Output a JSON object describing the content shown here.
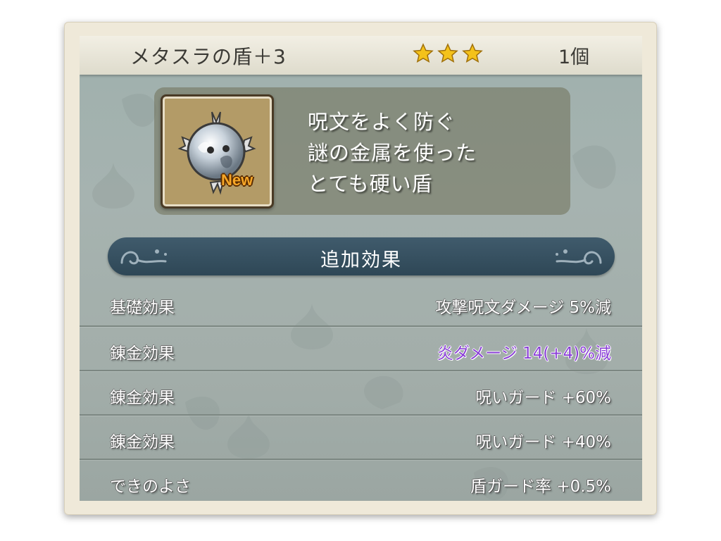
{
  "item": {
    "name": "メタスラの盾＋3",
    "rarity_stars": 3,
    "count": "1個",
    "is_new": true,
    "new_badge": "New",
    "icon": "metal-slime-shield-icon",
    "description_lines": [
      "呪文をよく防ぐ",
      "謎の金属を使った",
      "とても硬い盾"
    ]
  },
  "section": {
    "title": "追加効果"
  },
  "effects": [
    {
      "label": "基礎効果",
      "value": "攻撃呪文ダメージ 5%減"
    },
    {
      "label": "錬金効果",
      "value": "炎ダメージ 14(+4)%減",
      "highlight": true
    },
    {
      "label": "錬金効果",
      "value": "呪いガード +60%"
    },
    {
      "label": "錬金効果",
      "value": "呪いガード +40%"
    },
    {
      "label": "できのよさ",
      "value": "盾ガード率 +0.5%"
    }
  ],
  "colors": {
    "star": "#f4c21a",
    "highlight_text": "#8a3fd6",
    "section_bar": "#3a5464",
    "panel_bg": "#a4b1ae"
  }
}
